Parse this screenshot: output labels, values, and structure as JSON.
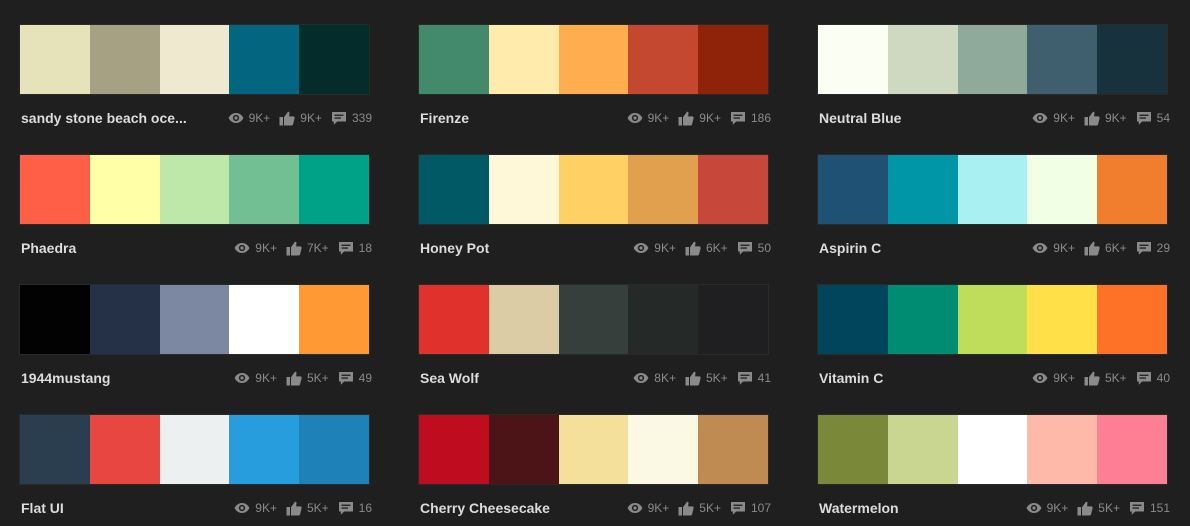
{
  "themes": [
    {
      "name": "sandy stone beach oce...",
      "colors": [
        "#e6e2b9",
        "#a7a184",
        "#efeacf",
        "#036580",
        "#032c2b"
      ],
      "views": "9K+",
      "appreciations": "9K+",
      "comments": "339"
    },
    {
      "name": "Firenze",
      "colors": [
        "#43896b",
        "#ffebac",
        "#ffad4f",
        "#c4472f",
        "#8e2309"
      ],
      "views": "9K+",
      "appreciations": "9K+",
      "comments": "186"
    },
    {
      "name": "Neutral Blue",
      "colors": [
        "#fbfff3",
        "#cfd8c1",
        "#8fa99b",
        "#3f5f6f",
        "#18323d"
      ],
      "views": "9K+",
      "appreciations": "9K+",
      "comments": "54"
    },
    {
      "name": "Phaedra",
      "colors": [
        "#ff5f47",
        "#ffffa7",
        "#bde8a9",
        "#72bf93",
        "#00a287"
      ],
      "views": "9K+",
      "appreciations": "7K+",
      "comments": "18"
    },
    {
      "name": "Honey Pot",
      "colors": [
        "#015965",
        "#fff8d8",
        "#ffd064",
        "#e0a04d",
        "#c7483b"
      ],
      "views": "9K+",
      "appreciations": "6K+",
      "comments": "50"
    },
    {
      "name": "Aspirin C",
      "colors": [
        "#1e5174",
        "#0096a8",
        "#a9f0f2",
        "#f1ffe4",
        "#f07e2c"
      ],
      "views": "9K+",
      "appreciations": "6K+",
      "comments": "29"
    },
    {
      "name": "1944mustang",
      "colors": [
        "#020202",
        "#243147",
        "#7c88a2",
        "#ffffff",
        "#ff9934"
      ],
      "views": "9K+",
      "appreciations": "5K+",
      "comments": "49"
    },
    {
      "name": "Sea Wolf",
      "colors": [
        "#e0312c",
        "#dbcca6",
        "#363f3c",
        "#252927",
        "#1f1f21"
      ],
      "views": "8K+",
      "appreciations": "5K+",
      "comments": "41"
    },
    {
      "name": "Vitamin C",
      "colors": [
        "#00455c",
        "#008c73",
        "#bfdd5a",
        "#ffe049",
        "#fe7228"
      ],
      "views": "9K+",
      "appreciations": "5K+",
      "comments": "40"
    },
    {
      "name": "Flat UI",
      "colors": [
        "#2a3e50",
        "#e84741",
        "#ecf0f1",
        "#289ddd",
        "#1e81b8"
      ],
      "views": "9K+",
      "appreciations": "5K+",
      "comments": "16"
    },
    {
      "name": "Cherry Cheesecake",
      "colors": [
        "#bf0c1e",
        "#4d1418",
        "#f4e09b",
        "#fbf8e4",
        "#c08b52"
      ],
      "views": "9K+",
      "appreciations": "5K+",
      "comments": "107"
    },
    {
      "name": "Watermelon",
      "colors": [
        "#7a883a",
        "#c9d691",
        "#ffffff",
        "#ffb9a9",
        "#fe7f94"
      ],
      "views": "9K+",
      "appreciations": "5K+",
      "comments": "151"
    }
  ],
  "icons": {
    "views": "eye-icon",
    "appreciations": "thumbs-up-icon",
    "comments": "comment-bubble-icon"
  },
  "colors": {
    "background": "#1f1f1f",
    "title_text": "#dcdcdc",
    "stat_text": "#8a8a8a"
  }
}
